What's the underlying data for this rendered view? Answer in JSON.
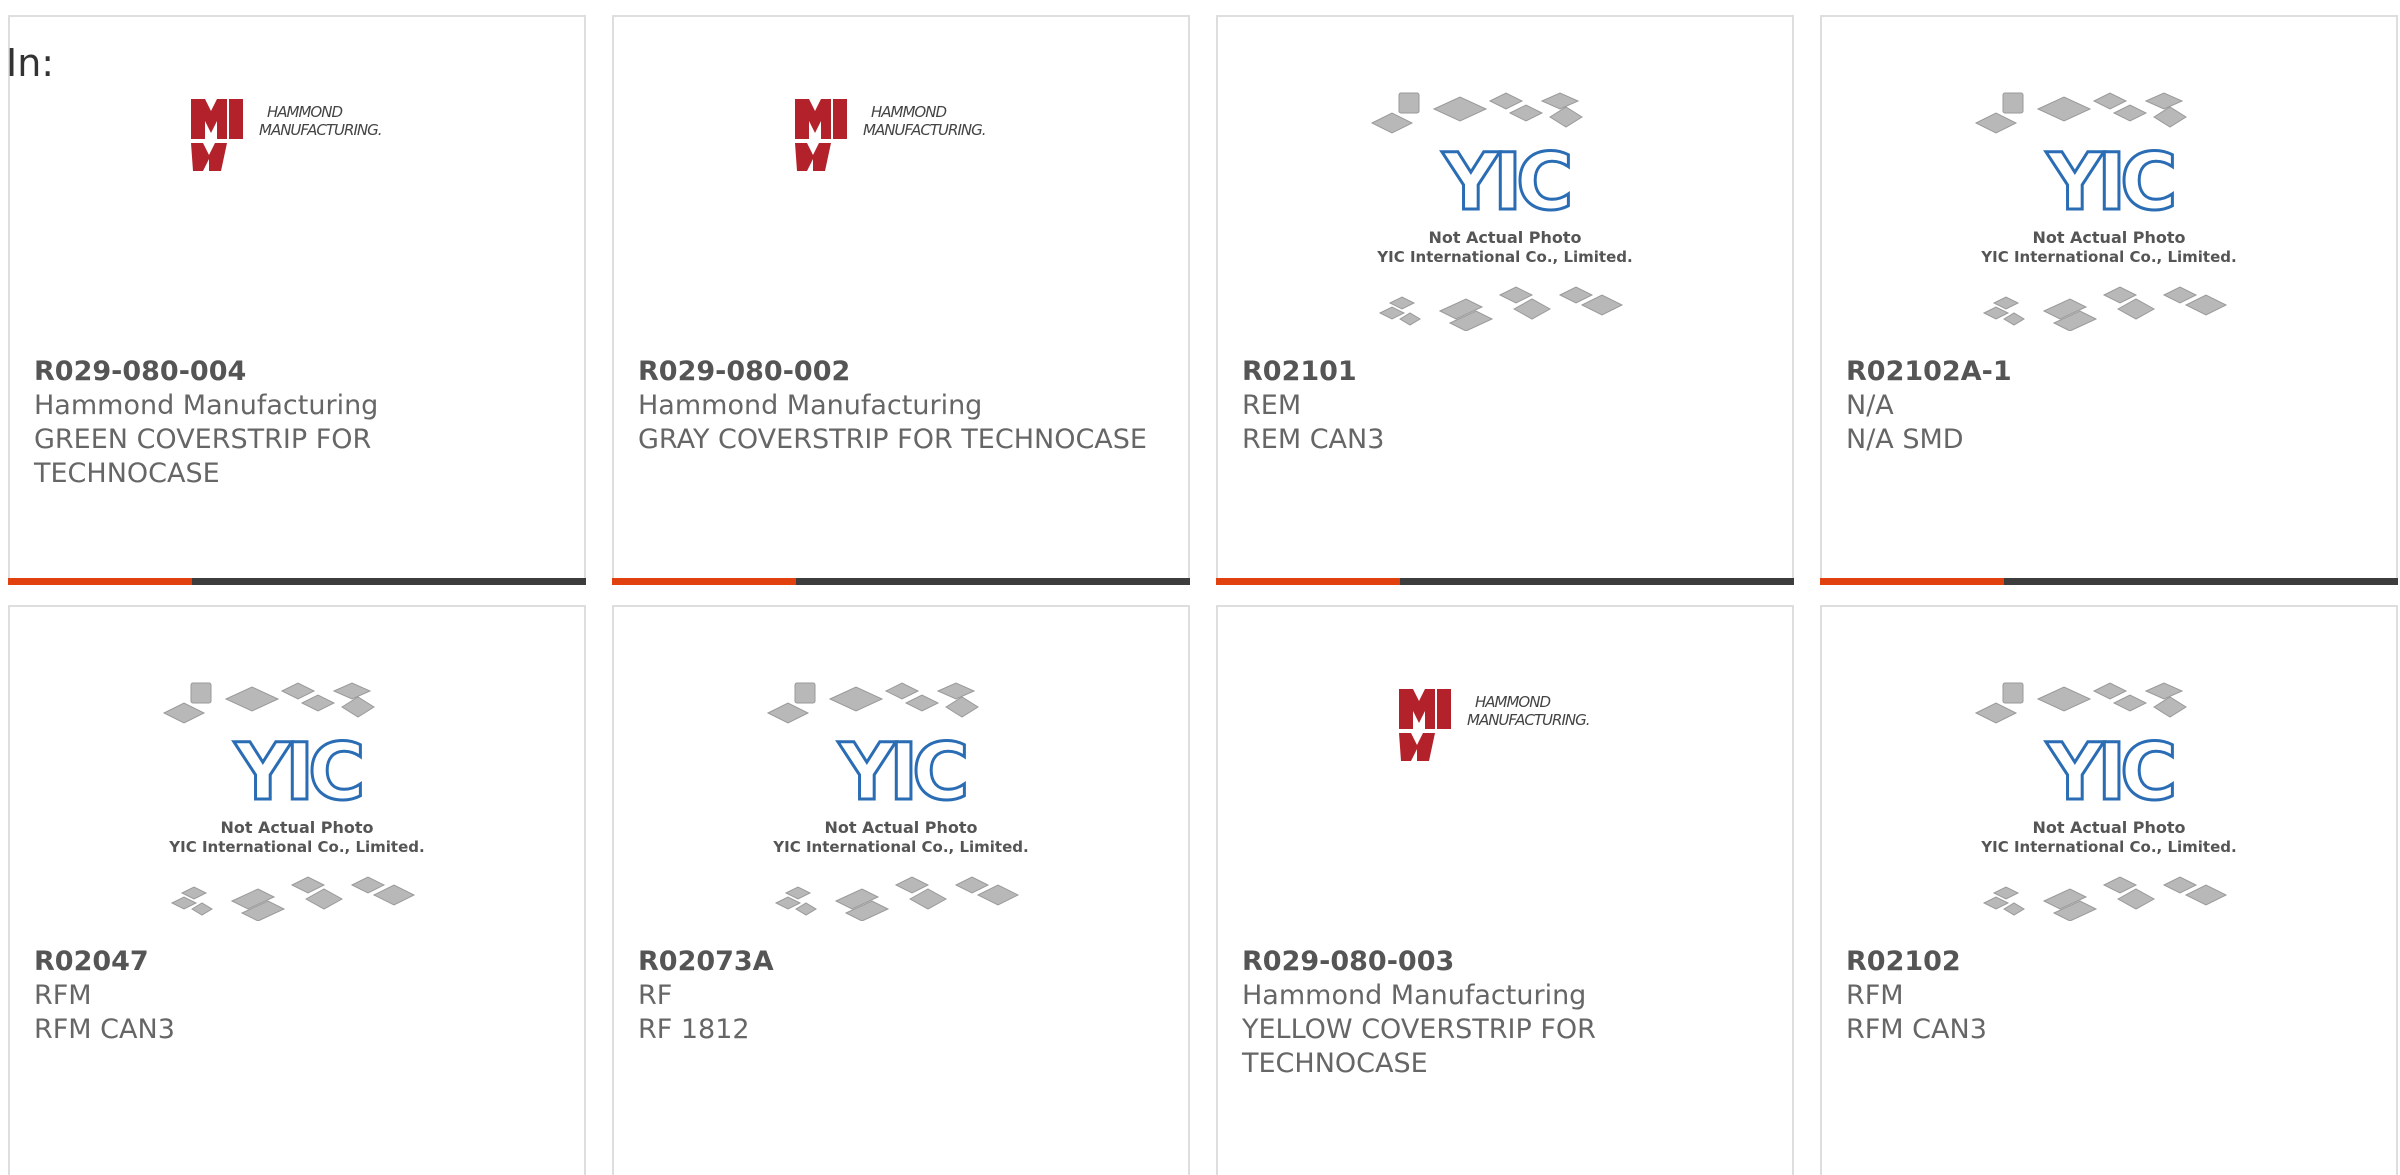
{
  "filter_label": "In:",
  "colors": {
    "accent": "#e0410f",
    "bar_dark": "#3d3d3d",
    "hammond_red": "#b3222a",
    "yic_blue": "#2a6db5"
  },
  "logos": {
    "hammond": {
      "line1": "HAMMOND",
      "line2": "MANUFACTURING."
    },
    "yic": {
      "mark": "YIC",
      "line1": "Not Actual Photo",
      "line2": "YIC International Co., Limited."
    }
  },
  "products": [
    {
      "part": "R029-080-004",
      "manufacturer": "Hammond Manufacturing",
      "description": "GREEN COVERSTRIP FOR TECHNOCASE",
      "logo": "hammond",
      "show_bar": true
    },
    {
      "part": "R029-080-002",
      "manufacturer": "Hammond Manufacturing",
      "description": "GRAY COVERSTRIP FOR TECHNOCASE",
      "logo": "hammond",
      "show_bar": true
    },
    {
      "part": "R02101",
      "manufacturer": "REM",
      "description": "REM CAN3",
      "logo": "yic",
      "show_bar": true
    },
    {
      "part": "R02102A-1",
      "manufacturer": "N/A",
      "description": "N/A SMD",
      "logo": "yic",
      "show_bar": true
    },
    {
      "part": "R02047",
      "manufacturer": "RFM",
      "description": "RFM CAN3",
      "logo": "yic",
      "show_bar": false
    },
    {
      "part": "R02073A",
      "manufacturer": "RF",
      "description": "RF 1812",
      "logo": "yic",
      "show_bar": false
    },
    {
      "part": "R029-080-003",
      "manufacturer": "Hammond Manufacturing",
      "description": "YELLOW COVERSTRIP FOR TECHNOCASE",
      "logo": "hammond",
      "show_bar": false
    },
    {
      "part": "R02102",
      "manufacturer": "RFM",
      "description": "RFM CAN3",
      "logo": "yic",
      "show_bar": false
    }
  ]
}
